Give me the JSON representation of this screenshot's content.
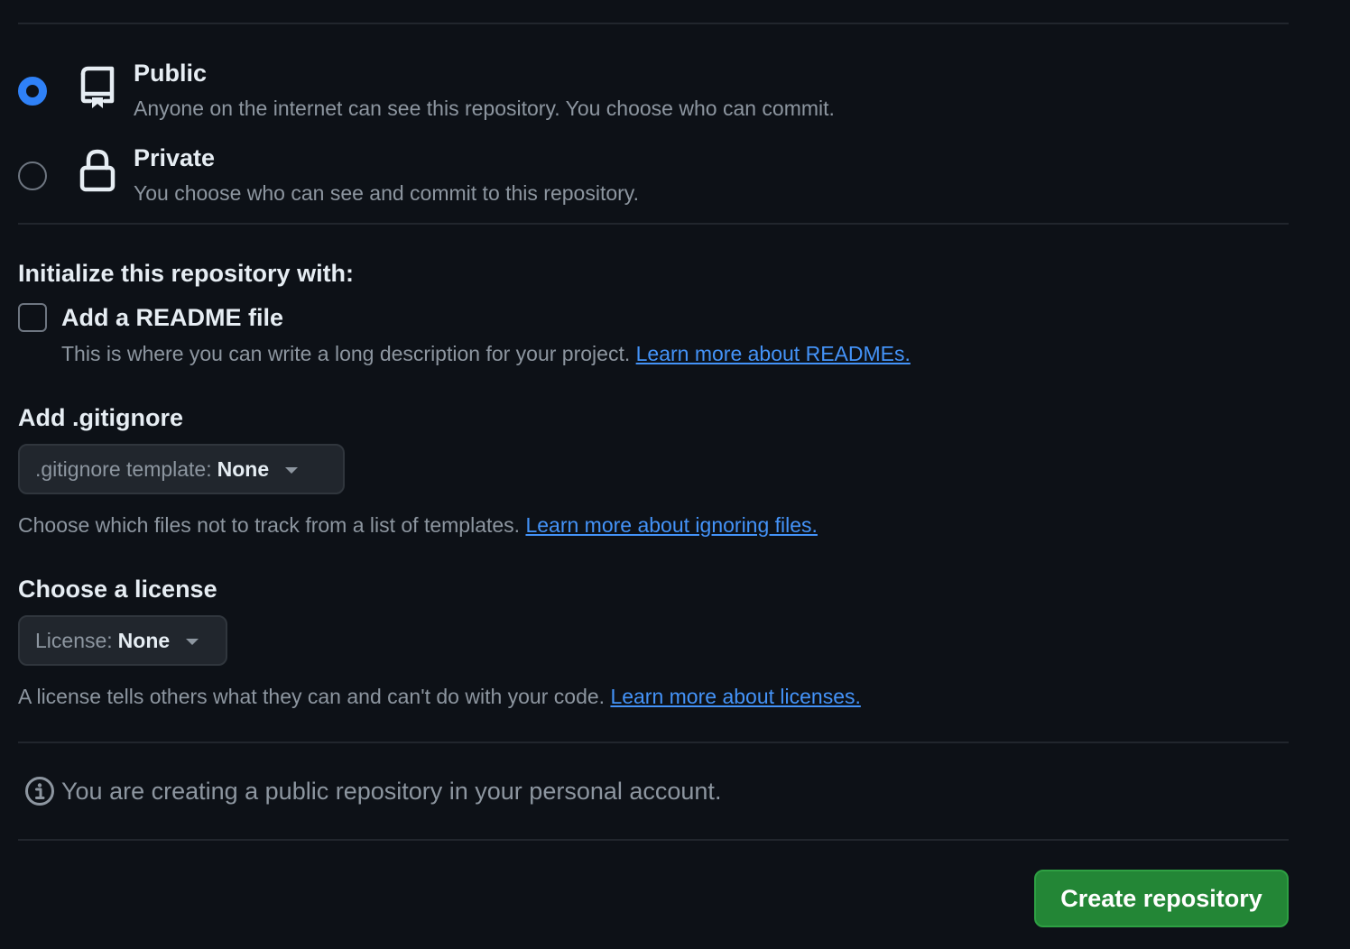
{
  "visibility": {
    "options": [
      {
        "title": "Public",
        "description": "Anyone on the internet can see this repository. You choose who can commit.",
        "selected": true,
        "icon": "repo-icon"
      },
      {
        "title": "Private",
        "description": "You choose who can see and commit to this repository.",
        "selected": false,
        "icon": "lock-icon"
      }
    ]
  },
  "initialize": {
    "heading": "Initialize this repository with:",
    "readme": {
      "label": "Add a README file",
      "checked": false,
      "description": "This is where you can write a long description for your project.",
      "link": "Learn more about READMEs."
    }
  },
  "gitignore": {
    "heading": "Add .gitignore",
    "select_prefix": ".gitignore template:",
    "select_value": "None",
    "help": "Choose which files not to track from a list of templates.",
    "link": "Learn more about ignoring files."
  },
  "license": {
    "heading": "Choose a license",
    "select_prefix": "License:",
    "select_value": "None",
    "help": "A license tells others what they can and can't do with your code.",
    "link": "Learn more about licenses."
  },
  "notice": {
    "icon": "info-icon",
    "text": "You are creating a public repository in your personal account."
  },
  "actions": {
    "create_label": "Create repository"
  },
  "colors": {
    "background": "#0d1117",
    "accent_blue": "#2f81f7",
    "link": "#4493f8",
    "primary_button": "#238636"
  }
}
